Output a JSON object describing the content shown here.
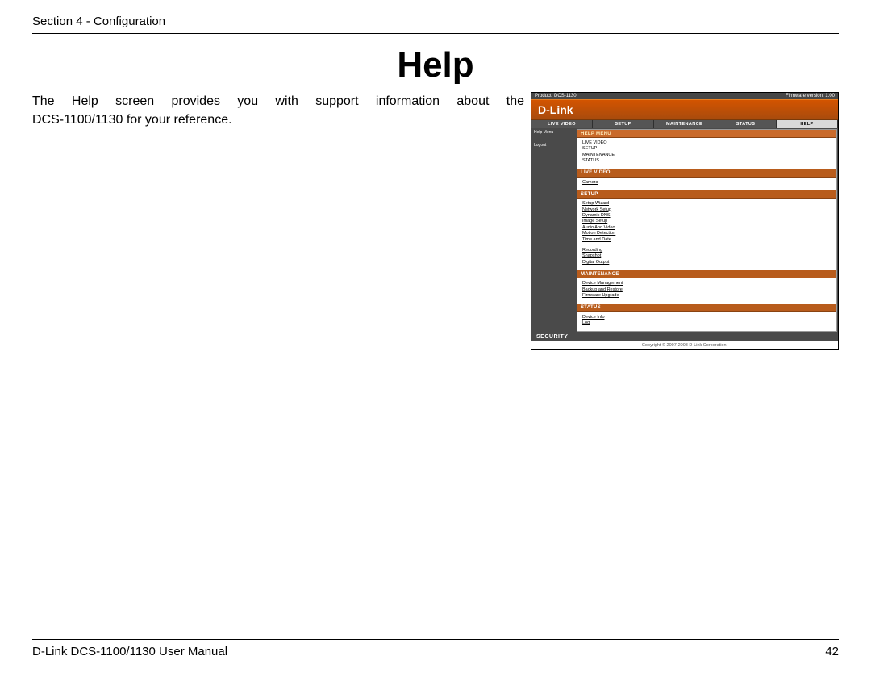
{
  "header": {
    "section": "Section 4 - Configuration"
  },
  "title": "Help",
  "body": {
    "line1": "The Help screen provides you with support information about the",
    "line2": "DCS-1100/1130 for your reference."
  },
  "screenshot": {
    "topbar": {
      "product_label": "Product:",
      "product_value": "DCS-1130",
      "firmware": "Firmware version: 1.00"
    },
    "brand": "D-Link",
    "tabs": [
      "LIVE VIDEO",
      "SETUP",
      "MAINTENANCE",
      "STATUS",
      "HELP"
    ],
    "sidebar": {
      "item1": "Help Menu",
      "item2": "Logout"
    },
    "sections": {
      "help_menu": {
        "title": "HELP MENU",
        "items": [
          "LIVE VIDEO",
          "SETUP",
          "MAINTENANCE",
          "STATUS"
        ]
      },
      "live_video": {
        "title": "LIVE VIDEO",
        "items": [
          "Camera"
        ]
      },
      "setup": {
        "title": "SETUP",
        "items": [
          "Setup Wizard",
          "Network Setup",
          "Dynamic DNS",
          "Image Setup",
          "Audio And Video",
          "Motion Detection",
          "Time and Date"
        ]
      },
      "setup2": {
        "items": [
          "Recording",
          "Snapshot",
          "Digital Output"
        ]
      },
      "maintenance": {
        "title": "MAINTENANCE",
        "items": [
          "Device Management",
          "Backup and Restore",
          "Firmware Upgrade"
        ]
      },
      "status": {
        "title": "STATUS",
        "items": [
          "Device Info",
          "Log"
        ]
      }
    },
    "bottom": "SECURITY",
    "copyright": "Copyright © 2007-2008 D-Link Corporation."
  },
  "footer": {
    "manual": "D-Link DCS-1100/1130 User Manual",
    "page": "42"
  }
}
